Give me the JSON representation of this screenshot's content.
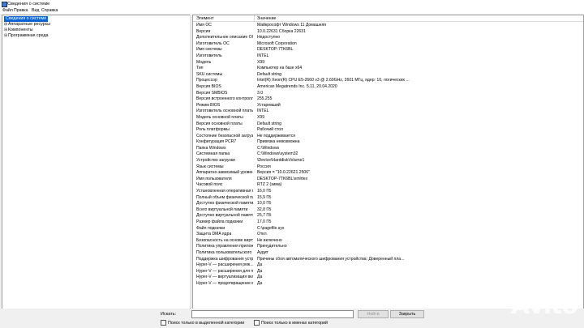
{
  "window": {
    "title": "Сведения о системе"
  },
  "menu": [
    "Файл",
    "Правка",
    "Вид",
    "Справка"
  ],
  "tree": [
    {
      "label": "Сведения о системе",
      "expander": "",
      "selected": true
    },
    {
      "label": "Аппаратные ресурсы",
      "expander": "⊞",
      "selected": false
    },
    {
      "label": "Компоненты",
      "expander": "⊞",
      "selected": false
    },
    {
      "label": "Программная среда",
      "expander": "⊞",
      "selected": false
    }
  ],
  "table": {
    "headers": [
      "Элемент",
      "Значение"
    ],
    "rows": [
      [
        "Имя ОС",
        "Майкрософт Windows 11 Домашняя"
      ],
      [
        "Версия",
        "10.0.22631 Сборка 22631"
      ],
      [
        "Дополнительное описание ОС",
        "Недоступно"
      ],
      [
        "Изготовитель ОС",
        "Microsoft Corporation"
      ],
      [
        "Имя системы",
        "DESKTOP-7TK6BL"
      ],
      [
        "Изготовитель",
        "INTEL"
      ],
      [
        "Модель",
        "X99"
      ],
      [
        "Тип",
        "Компьютер на базе x64"
      ],
      [
        "SKU системы",
        "Default string"
      ],
      [
        "Процессор",
        "Intel(R) Xeon(R) CPU E5-2660 v3 @ 2.60GHz, 2601 МГц, ядер: 10, логических ..."
      ],
      [
        "Версия BIOS",
        "American Megatrends Inc. 5.11, 20.04.2020"
      ],
      [
        "Версия SMBIOS",
        "3.0"
      ],
      [
        "Версия встроенного контролл...",
        "255.255"
      ],
      [
        "Режим BIOS",
        "Устаревший"
      ],
      [
        "Изготовитель основной платы",
        "INTEL"
      ],
      [
        "Модель основной платы",
        "X99"
      ],
      [
        "Версия основной платы",
        "Default string"
      ],
      [
        "Роль платформы",
        "Рабочий стол"
      ],
      [
        "Состояние безопасной загруз...",
        "Не поддерживается"
      ],
      [
        "Конфигурация PCR7",
        "Привязка невозможна"
      ],
      [
        "Папка Windows",
        "C:\\Windows"
      ],
      [
        "Системная папка",
        "C:\\Windows\\system32"
      ],
      [
        "Устройство загрузки",
        "\\Device\\HarddiskVolume1"
      ],
      [
        "Язык системы",
        "Россия"
      ],
      [
        "Аппаратно-зависимый уровен...",
        "Версия = \"10.0.22621.2506\""
      ],
      [
        "Имя пользователя",
        "DESKTOP-7TK6BL\\xmlrtex"
      ],
      [
        "Часовой пояс",
        "RTZ 2 (зима)"
      ],
      [
        "Установленная оперативная п...",
        "16,0 ГБ"
      ],
      [
        "Полный объем физической па...",
        "15,9 ГБ"
      ],
      [
        "Доступно физической памяти",
        "10,0 ГБ"
      ],
      [
        "Всего виртуальной памяти",
        "32,8 ГБ"
      ],
      [
        "Доступно виртуальной памяти",
        "25,7 ГБ"
      ],
      [
        "Размер файла подкачки",
        "17,0 ГБ"
      ],
      [
        "Файл подкачки",
        "C:\\pagefile.sys"
      ],
      [
        "Защита DMA ядра",
        "Откл."
      ],
      [
        "Безопасность на основе вирту...",
        "Не включено"
      ],
      [
        "Политика управления прилож...",
        "Принудительно"
      ],
      [
        "Политика пользовательского ...",
        "Аудит"
      ],
      [
        "Поддержка шифрования устр...",
        "Причины сбоя автоматического шифрования устройства: Доверенный пла..."
      ],
      [
        "Hyper-V — расширения реж...",
        "Да"
      ],
      [
        "Hyper-V — расширения для п...",
        "Да"
      ],
      [
        "Hyper-V — виртуализация вкл...",
        "Да"
      ],
      [
        "Hyper-V — предотвращение в...",
        "Да"
      ]
    ]
  },
  "bottom": {
    "search_label": "Искать:",
    "search_value": "",
    "find_button": "Найти",
    "close_button": "Закрыть",
    "checkbox_selected_category": "Поиск только в выделенной категории",
    "checkbox_category_names": "Поиск только в именах категорий"
  },
  "watermark": "Avito"
}
